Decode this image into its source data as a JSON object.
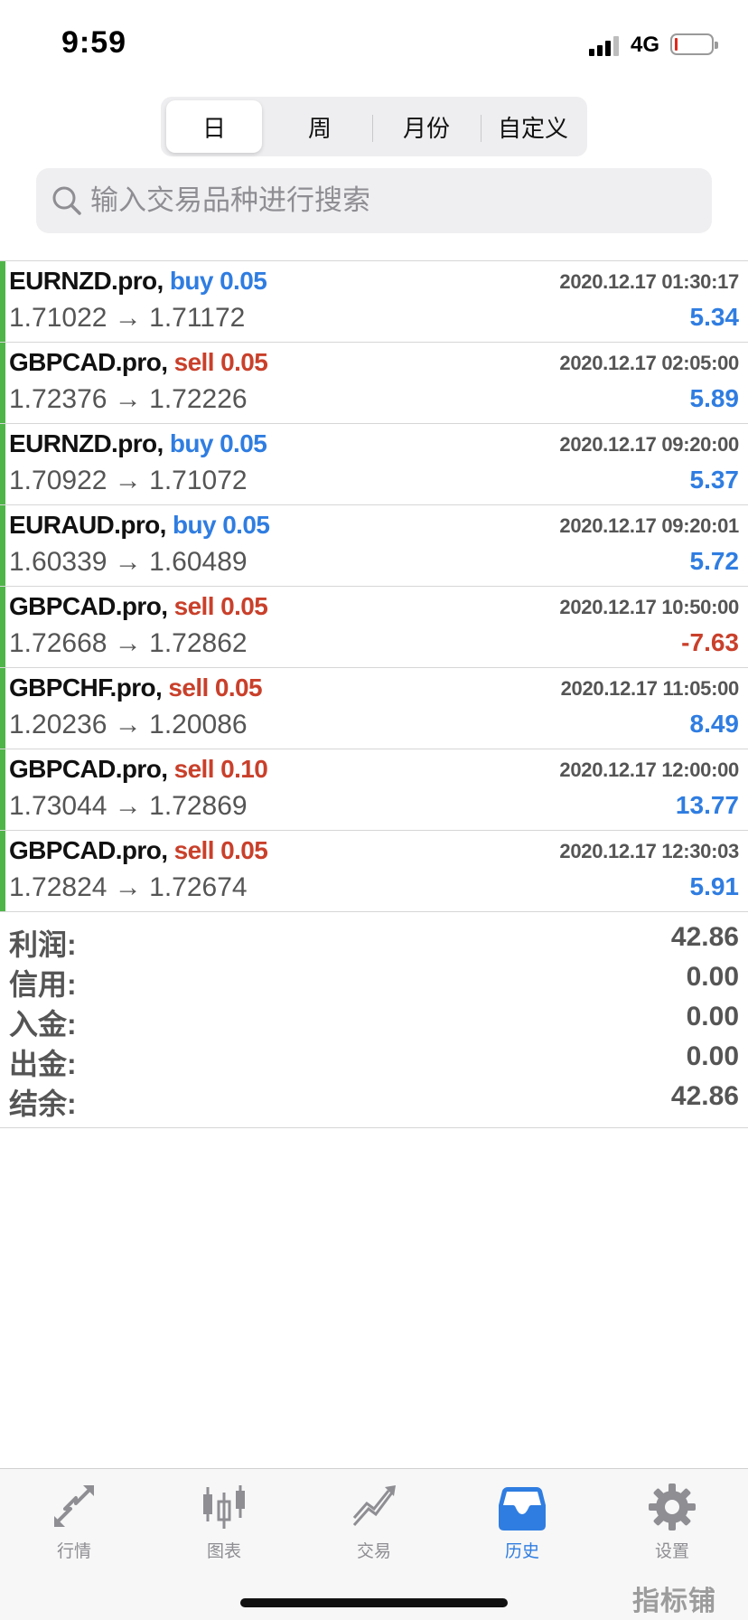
{
  "status": {
    "time": "9:59",
    "network": "4G"
  },
  "segments": {
    "day": "日",
    "week": "周",
    "month": "月份",
    "custom": "自定义",
    "active": "日"
  },
  "search": {
    "placeholder": "输入交易品种进行搜索",
    "icon": "search-icon"
  },
  "trades": [
    {
      "symbol": "EURNZD.pro",
      "side": "buy",
      "volume": "0.05",
      "time": "2020.12.17 01:30:17",
      "price_open": "1.71022",
      "price_close": "1.71172",
      "profit": "5.34"
    },
    {
      "symbol": "GBPCAD.pro",
      "side": "sell",
      "volume": "0.05",
      "time": "2020.12.17 02:05:00",
      "price_open": "1.72376",
      "price_close": "1.72226",
      "profit": "5.89"
    },
    {
      "symbol": "EURNZD.pro",
      "side": "buy",
      "volume": "0.05",
      "time": "2020.12.17 09:20:00",
      "price_open": "1.70922",
      "price_close": "1.71072",
      "profit": "5.37"
    },
    {
      "symbol": "EURAUD.pro",
      "side": "buy",
      "volume": "0.05",
      "time": "2020.12.17 09:20:01",
      "price_open": "1.60339",
      "price_close": "1.60489",
      "profit": "5.72"
    },
    {
      "symbol": "GBPCAD.pro",
      "side": "sell",
      "volume": "0.05",
      "time": "2020.12.17 10:50:00",
      "price_open": "1.72668",
      "price_close": "1.72862",
      "profit": "-7.63"
    },
    {
      "symbol": "GBPCHF.pro",
      "side": "sell",
      "volume": "0.05",
      "time": "2020.12.17 11:05:00",
      "price_open": "1.20236",
      "price_close": "1.20086",
      "profit": "8.49"
    },
    {
      "symbol": "GBPCAD.pro",
      "side": "sell",
      "volume": "0.10",
      "time": "2020.12.17 12:00:00",
      "price_open": "1.73044",
      "price_close": "1.72869",
      "profit": "13.77"
    },
    {
      "symbol": "GBPCAD.pro",
      "side": "sell",
      "volume": "0.05",
      "time": "2020.12.17 12:30:03",
      "price_open": "1.72824",
      "price_close": "1.72674",
      "profit": "5.91"
    }
  ],
  "arrow": "→",
  "summary": {
    "profit_label": "利润:",
    "profit": "42.86",
    "credit_label": "信用:",
    "credit": "0.00",
    "deposit_label": "入金:",
    "deposit": "0.00",
    "withdrawal_label": "出金:",
    "withdrawal": "0.00",
    "balance_label": "结余:",
    "balance": "42.86"
  },
  "tabbar": {
    "quotes": "行情",
    "chart": "图表",
    "trade": "交易",
    "history": "历史",
    "settings": "设置",
    "active": "历史"
  },
  "watermark": "指标铺",
  "colors": {
    "buy": "#2f7de1",
    "sell": "#c9402b",
    "accent": "#4fb548",
    "active_tab": "#2f7de1"
  }
}
